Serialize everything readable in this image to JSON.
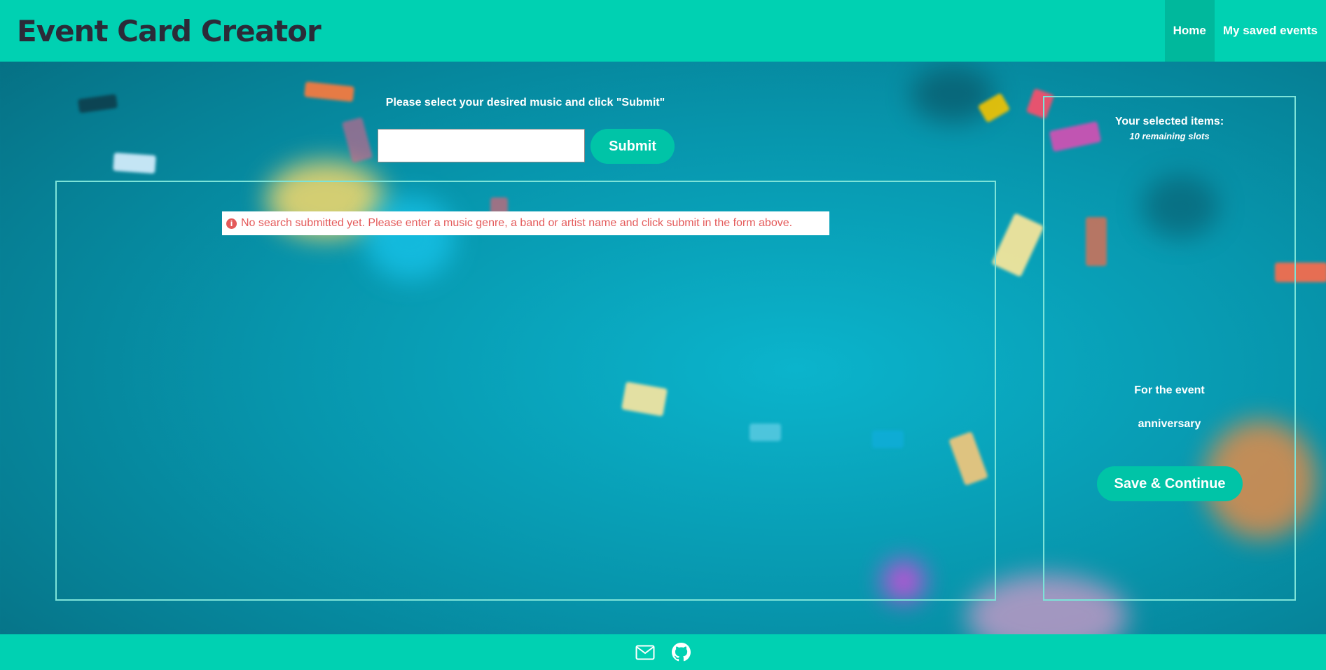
{
  "header": {
    "brand": "Event Card Creator",
    "nav": [
      {
        "label": "Home",
        "active": true
      },
      {
        "label": "My saved events",
        "active": false
      }
    ]
  },
  "search": {
    "prompt": "Please select your desired music and click \"Submit\"",
    "input_value": "",
    "placeholder": "",
    "submit_label": "Submit"
  },
  "results": {
    "notice": "No search submitted yet. Please enter a music genre, a band or artist name and click submit in the form above.",
    "notice_icon": "info-icon"
  },
  "sidebar": {
    "title": "Your selected items:",
    "remaining": "10 remaining slots",
    "event_label": "For the event",
    "event_name": "anniversary",
    "save_label": "Save & Continue"
  },
  "footer": {
    "icons": [
      "mail-icon",
      "github-icon"
    ]
  },
  "colors": {
    "accent": "#00d1b2",
    "button": "#00c4a7",
    "brand_text": "#2b2b38",
    "error_text": "#e45a5a"
  }
}
